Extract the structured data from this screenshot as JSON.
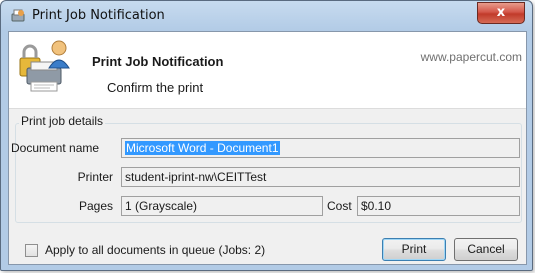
{
  "window": {
    "title": "Print Job Notification",
    "close_glyph": "x"
  },
  "header": {
    "title": "Print Job Notification",
    "subtitle": "Confirm the print",
    "url": "www.papercut.com",
    "icon": "printer-user-icon"
  },
  "details": {
    "group_label": "Print job details",
    "document_name_label": "Document name",
    "document_name_value": "Microsoft Word - Document1",
    "printer_label": "Printer",
    "printer_value": "student-iprint-nw\\CEITTest",
    "pages_label": "Pages",
    "pages_value": "1  (Grayscale)",
    "cost_label": "Cost",
    "cost_value": "$0.10"
  },
  "footer": {
    "apply_all_label": "Apply to all documents in queue (Jobs: 2)",
    "apply_all_checked": false,
    "print_button": "Print",
    "cancel_button": "Cancel"
  },
  "colors": {
    "selection": "#3399ff",
    "close": "#c13a2a"
  }
}
